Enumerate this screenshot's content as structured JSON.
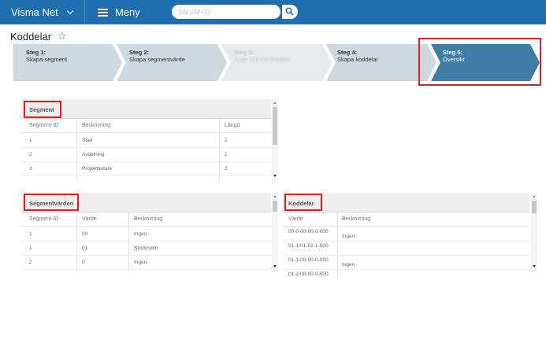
{
  "topbar": {
    "company": "Visma Net",
    "menu_label": "Meny",
    "search_placeholder": "Sök (Alt+S)"
  },
  "page": {
    "title": "Koddelar"
  },
  "wizard": {
    "steps": [
      {
        "title": "Steg 1:",
        "label": "Skapa segment",
        "state": "done"
      },
      {
        "title": "Steg 2:",
        "label": "Skapa segmentvärde",
        "state": "done"
      },
      {
        "title": "Steg 3:",
        "label": "Ange standardkoddel",
        "state": "disabled"
      },
      {
        "title": "Steg 4:",
        "label": "Skapa koddelar",
        "state": "done"
      },
      {
        "title": "Steg 5:",
        "label": "Översikt",
        "state": "active"
      }
    ]
  },
  "segment": {
    "title": "Segment",
    "columns": [
      "Segment-ID",
      "Beskrivning",
      "Längd"
    ],
    "rows": [
      [
        "1",
        "Stad",
        "2"
      ],
      [
        "2",
        "Avdelning",
        "1"
      ],
      [
        "3",
        "Projektledare",
        "2"
      ]
    ]
  },
  "segmentvarden": {
    "title": "Segmentvärden",
    "columns": [
      "Segment-ID",
      "Värde",
      "Beskrivning"
    ],
    "rows": [
      [
        "1",
        "00",
        "Ingen"
      ],
      [
        "1",
        "01",
        "Stockholm"
      ],
      [
        "2",
        "0",
        "Ingen"
      ]
    ]
  },
  "koddelar": {
    "title": "Koddelar",
    "columns": [
      "Värde",
      "Beskrivning"
    ],
    "rows": [
      [
        "00-0-00-00-0-000",
        "Ingen"
      ],
      [
        "01-1-01-01-1-000",
        ""
      ],
      [
        "01-1-00-00-0-000",
        "Ingen"
      ],
      [
        "01-2-00-00-0-000",
        ""
      ]
    ]
  },
  "colors": {
    "topbar": "#1f6fb0",
    "step_active": "#3e7da6",
    "step_done": "#cdd8df",
    "highlight": "#e02020"
  }
}
